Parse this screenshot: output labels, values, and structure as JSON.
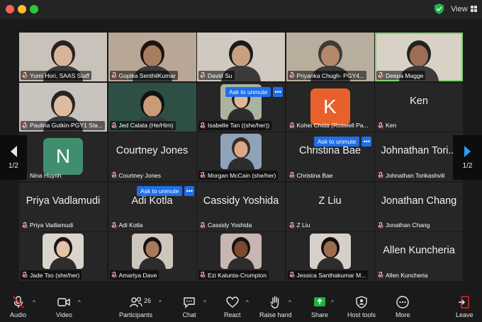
{
  "window": {
    "view_label": "View"
  },
  "tiles": [
    {
      "type": "video",
      "name": "Yumi Hori, SAAS Staff",
      "color": "#c9c2ba",
      "skin": "#d9b49a",
      "hair": "#2a2220"
    },
    {
      "type": "video",
      "name": "Gopika SenthilKumar",
      "color": "#b8a796",
      "skin": "#a97c5d",
      "hair": "#1c1412"
    },
    {
      "type": "video",
      "name": "David Su",
      "color": "#cfc9c0",
      "skin": "#c9a07f",
      "hair": "#1a1a1a"
    },
    {
      "type": "video",
      "name": "Priyanka Chugh- PGY4...",
      "color": "#b9ad9d",
      "skin": "#b58869",
      "hair": "#3d3a3a"
    },
    {
      "type": "video",
      "name": "Deepa Magge",
      "color": "#d8d2c6",
      "skin": "#9c6f55",
      "hair": "#222"
    },
    {
      "type": "video",
      "name": "Paulina Gutkin-PGY1 Sta...",
      "color": "#c8c3bd",
      "skin": "#dcbba0",
      "hair": "#2b2320"
    },
    {
      "type": "video",
      "name": "Jed Calata (He/Him)",
      "color": "#2e4f45",
      "skin": "#c99c78",
      "hair": "#111"
    },
    {
      "type": "photo",
      "name": "Isabelle Tan ((she/her))",
      "color": "#a9b4a0",
      "skin": "#e0b898",
      "hair": "#2a1e18"
    },
    {
      "type": "letter",
      "name": "Kohei Chida (Roswell Pa...",
      "letter": "K",
      "avatar_color": "#e8612c"
    },
    {
      "type": "text",
      "name": "Ken",
      "big": "Ken"
    },
    {
      "type": "letter",
      "name": "Nina Huynh",
      "letter": "N",
      "avatar_color": "#3f8f6e"
    },
    {
      "type": "text",
      "name": "Courtney Jones",
      "big": "Courtney Jones"
    },
    {
      "type": "photo",
      "name": "Morgan McCain (she/her)",
      "color": "#8fa3b8",
      "skin": "#d8a88a",
      "hair": "#3b2a20"
    },
    {
      "type": "text",
      "name": "Christina Bae",
      "big": "Christina Bae"
    },
    {
      "type": "text",
      "name": "Johnathan Torikashvili",
      "big": "Johnathan Tori..."
    },
    {
      "type": "text",
      "name": "Priya Vadlamudi",
      "big": "Priya Vadlamudi"
    },
    {
      "type": "text",
      "name": "Adi Kotla",
      "big": "Adi Kotla"
    },
    {
      "type": "text",
      "name": "Cassidy Yoshida",
      "big": "Cassidy Yoshida"
    },
    {
      "type": "text",
      "name": "Z Liu",
      "big": "Z Liu"
    },
    {
      "type": "text",
      "name": "Jonathan Chang",
      "big": "Jonathan Chang"
    },
    {
      "type": "photo",
      "name": "Jade Tso (she/her)",
      "color": "#d9d4cc",
      "skin": "#e4c2a6",
      "hair": "#1b1412"
    },
    {
      "type": "photo",
      "name": "Amartya Dave",
      "color": "#cdc6bd",
      "skin": "#a87a5c",
      "hair": "#151010"
    },
    {
      "type": "photo",
      "name": "Ezi Kalunta-Crumpton",
      "color": "#c7b6b1",
      "skin": "#7a4b33",
      "hair": "#1a1210"
    },
    {
      "type": "photo",
      "name": "Jessica Santhakumar M...",
      "color": "#d5d0ca",
      "skin": "#9c6c50",
      "hair": "#120c0a"
    },
    {
      "type": "text",
      "name": "Allen Kuncheria",
      "big": "Allen Kuncheria"
    }
  ],
  "unmute": {
    "label": "Ask to unmute",
    "more": "•••"
  },
  "pager": {
    "left": "1/2",
    "right": "1/2"
  },
  "toolbar": {
    "audio": "Audio",
    "video": "Video",
    "participants": "Participants",
    "participants_count": "26",
    "chat": "Chat",
    "react": "React",
    "raise_hand": "Raise hand",
    "share": "Share",
    "host_tools": "Host tools",
    "more": "More",
    "leave": "Leave"
  },
  "colors": {
    "active_border": "#7dd36b",
    "unmute_blue": "#1f6feb",
    "share_green": "#1fb141",
    "muted_red": "#e02828",
    "leave_red": "#e02828"
  }
}
